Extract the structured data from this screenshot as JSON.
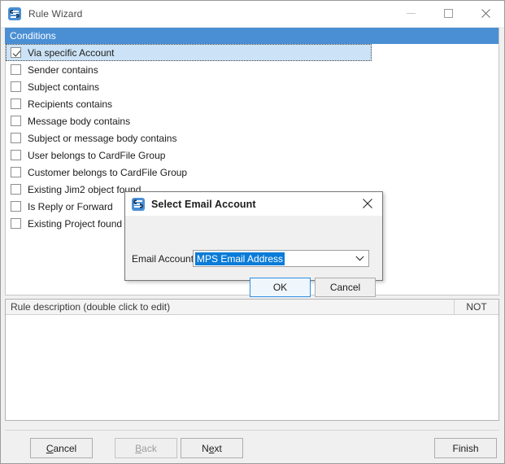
{
  "window": {
    "title": "Rule Wizard",
    "icon": "jim2-app-icon",
    "controls": {
      "minimize": "minimize-icon",
      "maximize": "maximize-icon",
      "close": "close-icon"
    }
  },
  "conditions": {
    "header": "Conditions",
    "items": [
      {
        "label": "Via specific Account",
        "checked": true,
        "selected": true
      },
      {
        "label": "Sender contains",
        "checked": false,
        "selected": false
      },
      {
        "label": "Subject contains",
        "checked": false,
        "selected": false
      },
      {
        "label": "Recipients contains",
        "checked": false,
        "selected": false
      },
      {
        "label": "Message body contains",
        "checked": false,
        "selected": false
      },
      {
        "label": "Subject or message body contains",
        "checked": false,
        "selected": false
      },
      {
        "label": "User belongs to CardFile Group",
        "checked": false,
        "selected": false
      },
      {
        "label": "Customer belongs to CardFile Group",
        "checked": false,
        "selected": false
      },
      {
        "label": "Existing Jim2 object found",
        "checked": false,
        "selected": false
      },
      {
        "label": "Is Reply or Forward",
        "checked": false,
        "selected": false
      },
      {
        "label": "Existing Project found",
        "checked": false,
        "selected": false
      }
    ]
  },
  "rule_description": {
    "column_description": "Rule description (double click to edit)",
    "column_not": "NOT",
    "rows": []
  },
  "footer": {
    "cancel": {
      "pre": "",
      "accel": "C",
      "post": "ancel",
      "disabled": false
    },
    "back": {
      "pre": "",
      "accel": "B",
      "post": "ack",
      "disabled": true
    },
    "next": {
      "pre": "N",
      "accel": "e",
      "post": "xt",
      "disabled": false
    },
    "finish": {
      "label": "Finish",
      "disabled": false
    }
  },
  "dialog": {
    "title": "Select Email Account",
    "icon": "jim2-app-icon",
    "close_icon": "close-icon",
    "field_label": "Email Account",
    "combo_value": "MPS Email Address",
    "combo_arrow": "chevron-down-icon",
    "ok": "OK",
    "cancel": "Cancel"
  },
  "colors": {
    "header_blue": "#4a8fd4",
    "selection_blue": "#cce3f7",
    "combo_highlight": "#0a7cd8",
    "default_button_border": "#2f8fe0"
  }
}
